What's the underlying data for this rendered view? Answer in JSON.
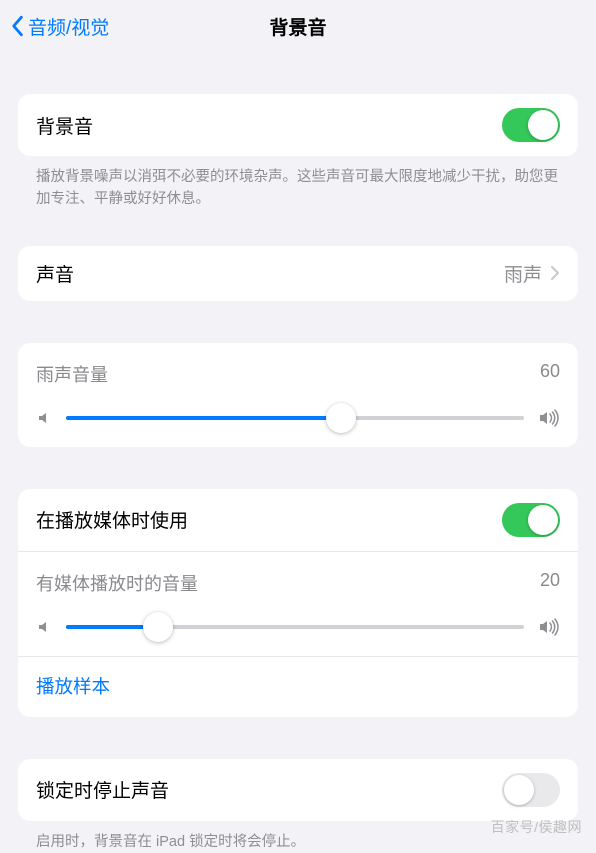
{
  "nav": {
    "back_label": "音频/视觉",
    "title": "背景音"
  },
  "master": {
    "label": "背景音",
    "enabled": true,
    "footer": "播放背景噪声以消弭不必要的环境杂声。这些声音可最大限度地减少干扰，助您更加专注、平静或好好休息。"
  },
  "sound": {
    "label": "声音",
    "value": "雨声"
  },
  "volume": {
    "label": "雨声音量",
    "value": "60",
    "percent": 60
  },
  "media": {
    "use_label": "在播放媒体时使用",
    "use_enabled": true,
    "vol_label": "有媒体播放时的音量",
    "vol_value": "20",
    "vol_percent": 20,
    "sample_label": "播放样本"
  },
  "lock": {
    "label": "锁定时停止声音",
    "enabled": false,
    "footer": "启用时，背景音在 iPad 锁定时将会停止。"
  },
  "watermark": "百家号/侯趣网"
}
